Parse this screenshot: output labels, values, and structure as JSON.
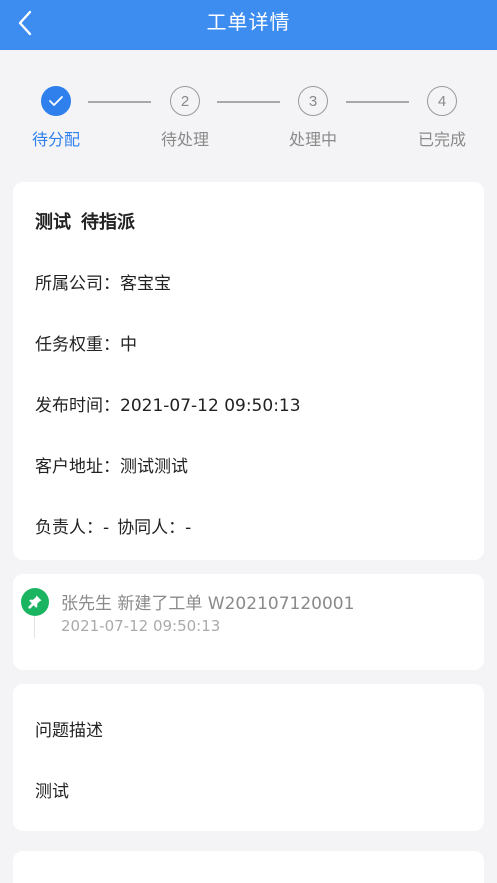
{
  "header": {
    "title": "工单详情",
    "back_icon": "chevron-left-icon"
  },
  "colors": {
    "nav_bg": "#3d8cf0",
    "active_step": "#2f80ed",
    "pin_bg": "#1bb561"
  },
  "steps": [
    {
      "label": "待分配",
      "number": "",
      "state": "done",
      "icon": "check-icon"
    },
    {
      "label": "待处理",
      "number": "2",
      "state": "pending"
    },
    {
      "label": "处理中",
      "number": "3",
      "state": "pending"
    },
    {
      "label": "已完成",
      "number": "4",
      "state": "pending"
    }
  ],
  "detail": {
    "title_name": "测试",
    "title_status": "待指派",
    "company_label": "所属公司：",
    "company_value": "客宝宝",
    "weight_label": "任务权重：",
    "weight_value": "中",
    "time_label": "发布时间：",
    "time_value": "2021-07-12 09:50:13",
    "address_label": "客户地址：",
    "address_value": "测试测试",
    "owner_label": "负责人：",
    "owner_value": "-",
    "assist_label": "协同人：",
    "assist_value": "-"
  },
  "log": {
    "icon": "pin-icon",
    "text": "张先生 新建了工单 W202107120001",
    "time": "2021-07-12 09:50:13"
  },
  "description": {
    "label": "问题描述",
    "value": "测试"
  }
}
